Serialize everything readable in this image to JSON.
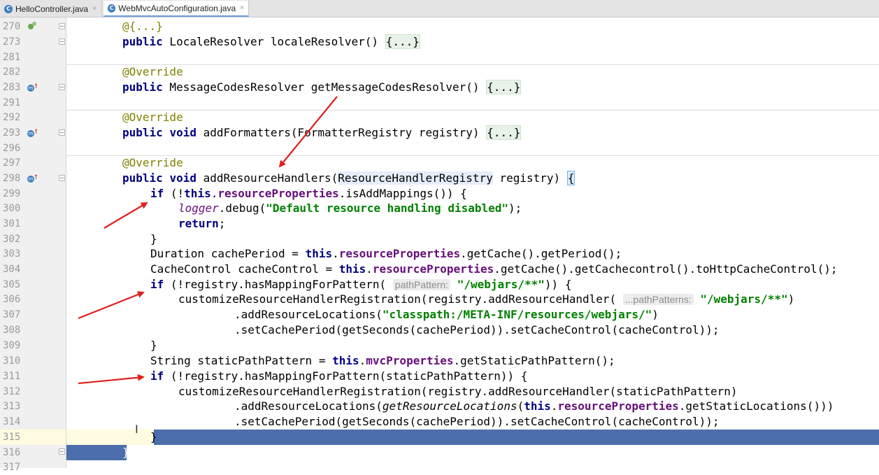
{
  "tabs": [
    {
      "icon": "C",
      "label": "HelloController.java",
      "close": "×",
      "active": false
    },
    {
      "icon": "C",
      "label": "WebMvcAutoConfiguration.java",
      "close": "×",
      "active": true
    }
  ],
  "line_numbers": [
    "270",
    "273",
    "281",
    "282",
    "283",
    "291",
    "292",
    "293",
    "296",
    "297",
    "298",
    "299",
    "300",
    "301",
    "302",
    "303",
    "304",
    "305",
    "306",
    "307",
    "308",
    "309",
    "310",
    "311",
    "312",
    "313",
    "314",
    "315",
    "316",
    "317"
  ],
  "code": {
    "l270": "@{...}",
    "l273_kw": "public",
    "l273_text": " LocaleResolver localeResolver() ",
    "l273_fold": "{...}",
    "l282": "@Override",
    "l283_kw": "public",
    "l283_text": " MessageCodesResolver getMessageCodesResolver() ",
    "l283_fold": "{...}",
    "l292": "@Override",
    "l293_kw1": "public",
    "l293_kw2": "void",
    "l293_text": " addFormatters(FormatterRegistry registry) ",
    "l293_fold": "{...}",
    "l297": "@Override",
    "l298_kw1": "public",
    "l298_kw2": "void",
    "l298_a": " addResourceHandlers(",
    "l298_type": "ResourceHandlerRegistry",
    "l298_b": " registry) ",
    "l298_brace": "{",
    "l299_if": "if",
    "l299_a": " (!",
    "l299_this": "this",
    "l299_dot": ".",
    "l299_field": "resourceProperties",
    "l299_b": ".isAddMappings()) {",
    "l300_logger": "logger",
    "l300_a": ".debug(",
    "l300_str": "\"Default resource handling disabled\"",
    "l300_b": ");",
    "l301_ret": "return",
    "l301_b": ";",
    "l302": "}",
    "l303_a": "Duration cachePeriod = ",
    "l303_this": "this",
    "l303_dot": ".",
    "l303_field": "resourceProperties",
    "l303_b": ".getCache().getPeriod();",
    "l304_a": "CacheControl cacheControl = ",
    "l304_this": "this",
    "l304_dot": ".",
    "l304_field": "resourceProperties",
    "l304_b": ".getCache().getCachecontrol().toHttpCacheControl();",
    "l305_if": "if",
    "l305_a": " (!registry.hasMappingForPattern( ",
    "l305_hint": "pathPattern:",
    "l305_str": " \"/webjars/**\"",
    "l305_b": ")) {",
    "l306_a": "customizeResourceHandlerRegistration(registry.addResourceHandler( ",
    "l306_hint": "...pathPatterns:",
    "l306_str": " \"/webjars/**\"",
    "l306_b": ")",
    "l307_a": ".addResourceLocations(",
    "l307_str": "\"classpath:/META-INF/resources/webjars/\"",
    "l307_b": ")",
    "l308": ".setCachePeriod(getSeconds(cachePeriod)).setCacheControl(cacheControl));",
    "l309": "}",
    "l310_a": "String staticPathPattern = ",
    "l310_this": "this",
    "l310_dot": ".",
    "l310_field": "mvcProperties",
    "l310_b": ".getStaticPathPattern();",
    "l311_if": "if",
    "l311_a": " (!registry.hasMappingForPattern(staticPathPattern)) {",
    "l312": "customizeResourceHandlerRegistration(registry.addResourceHandler(staticPathPattern)",
    "l313_a": ".addResourceLocations(",
    "l313_ital": "getResourceLocations",
    "l313_b": "(",
    "l313_this": "this",
    "l313_dot": ".",
    "l313_field": "resourceProperties",
    "l313_c": ".getStaticLocations()))",
    "l314": ".setCachePeriod(getSeconds(cachePeriod)).setCacheControl(cacheControl));",
    "l315": "}",
    "l316": "}"
  }
}
